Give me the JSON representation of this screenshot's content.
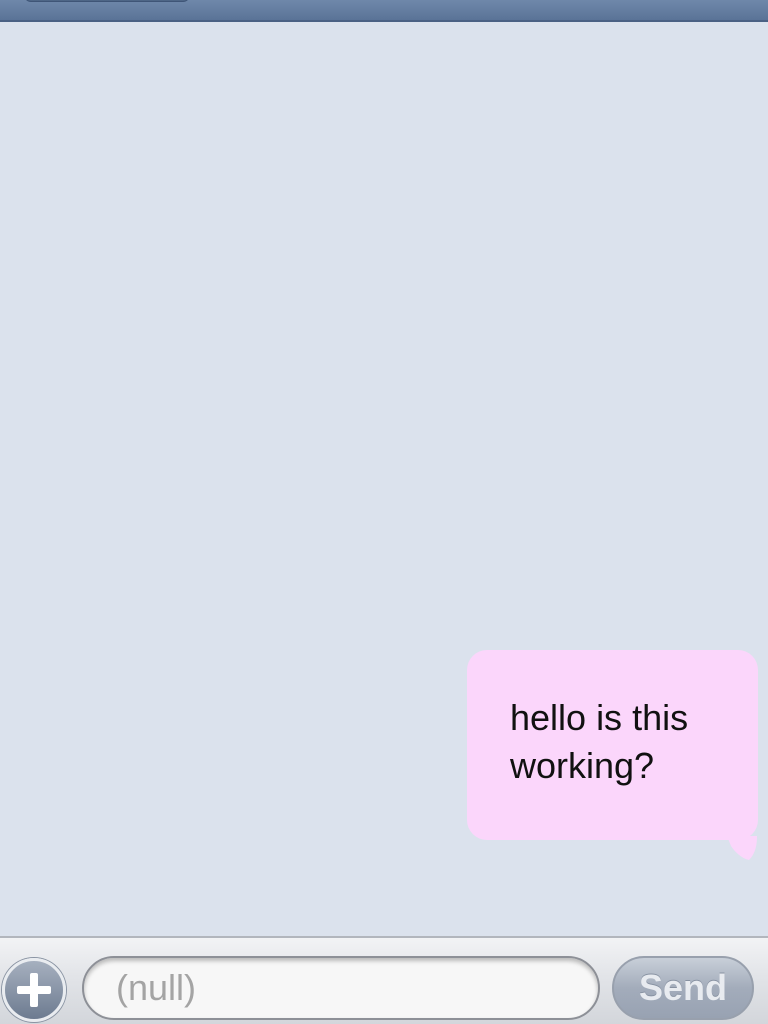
{
  "nav": {
    "back_label": ""
  },
  "conversation": {
    "messages": [
      {
        "sender": "me",
        "text": "hello is this working?"
      }
    ]
  },
  "composer": {
    "add_icon": "plus-icon",
    "input_value": "",
    "input_placeholder": "(null)",
    "send_label": "Send"
  },
  "colors": {
    "background": "#dbe2ed",
    "outgoing_bubble": "#fbd6fb",
    "nav_bar": "#5a7397",
    "send_button": "#a3acbb"
  }
}
